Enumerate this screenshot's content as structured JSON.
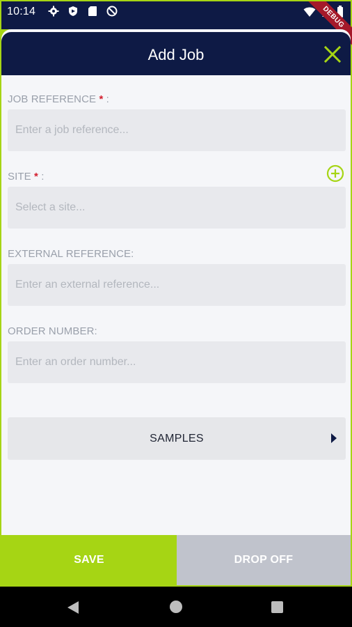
{
  "status_bar": {
    "time": "10:14",
    "icons_left": [
      "settings-icon",
      "shield-icon",
      "sd-card-icon",
      "no-entry-icon"
    ],
    "icons_right": [
      "wifi-icon",
      "cell-signal-icon",
      "battery-icon"
    ]
  },
  "debug_banner": "DEBUG",
  "header": {
    "title": "Add Job",
    "close_icon": "close-icon"
  },
  "form": {
    "job_reference": {
      "label": "JOB REFERENCE",
      "required_mark": "*",
      "label_suffix": " :",
      "value": "",
      "placeholder": "Enter a job reference..."
    },
    "site": {
      "label": "SITE",
      "required_mark": "*",
      "label_suffix": " :",
      "value": "",
      "placeholder": "Select a site..."
    },
    "external_reference": {
      "label": "EXTERNAL REFERENCE:",
      "value": "",
      "placeholder": "Enter an external reference..."
    },
    "order_number": {
      "label": "ORDER NUMBER:",
      "value": "",
      "placeholder": "Enter an order number..."
    }
  },
  "samples_button": {
    "label": "SAMPLES"
  },
  "bottom_bar": {
    "save_label": "SAVE",
    "drop_off_label": "DROP OFF"
  },
  "colors": {
    "brand_navy": "#0e1a45",
    "accent_green": "#a6d514",
    "required_red": "#d3202f",
    "disabled_gray": "#c0c3cc"
  }
}
